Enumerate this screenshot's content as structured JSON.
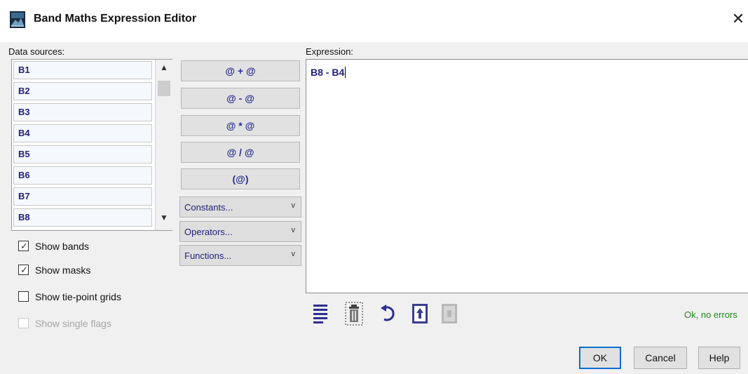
{
  "window": {
    "title": "Band Maths Expression Editor",
    "close_glyph": "✕"
  },
  "data_sources": {
    "label": "Data sources:",
    "items": [
      "B1",
      "B2",
      "B3",
      "B4",
      "B5",
      "B6",
      "B7",
      "B8"
    ],
    "scroll_up_glyph": "▲",
    "scroll_down_glyph": "▼"
  },
  "checkboxes": [
    {
      "label": "Show bands",
      "checked": true,
      "enabled": true
    },
    {
      "label": "Show masks",
      "checked": true,
      "enabled": true
    },
    {
      "label": "Show tie-point grids",
      "checked": false,
      "enabled": true
    },
    {
      "label": "Show single flags",
      "checked": false,
      "enabled": false
    }
  ],
  "operators": [
    "@ + @",
    "@ - @",
    "@ * @",
    "@ / @",
    "(@)"
  ],
  "dropdowns": [
    {
      "label": "Constants...",
      "chevron": "v"
    },
    {
      "label": "Operators...",
      "chevron": "v"
    },
    {
      "label": "Functions...",
      "chevron": "v"
    }
  ],
  "expression": {
    "label": "Expression:",
    "value": "B8 - B4"
  },
  "tools": [
    {
      "icon": "edit-expression-icon"
    },
    {
      "icon": "clear-delete-icon"
    },
    {
      "icon": "undo-icon"
    },
    {
      "icon": "load-expression-icon"
    },
    {
      "icon": "save-expression-icon"
    }
  ],
  "status": {
    "text": "Ok, no errors",
    "color": "#1e8a1e"
  },
  "buttons": {
    "ok": "OK",
    "cancel": "Cancel",
    "help": "Help"
  },
  "colors": {
    "band_text": "#22207a",
    "operator_text": "#2c2f8f",
    "default_button_border": "#0a6fd1"
  }
}
